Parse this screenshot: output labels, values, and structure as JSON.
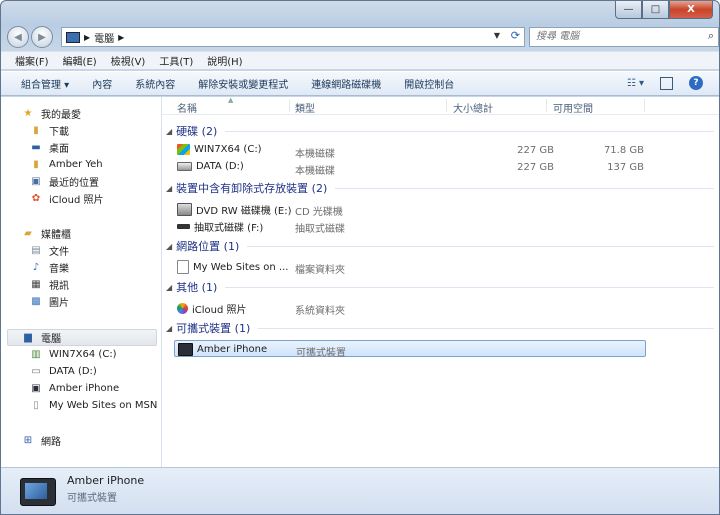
{
  "window": {
    "controls": {
      "minimize": "—",
      "maximize": "□",
      "close": "X"
    }
  },
  "address": {
    "breadcrumb": "電腦",
    "search_placeholder": "搜尋 電腦"
  },
  "menu": [
    "檔案(F)",
    "編輯(E)",
    "檢視(V)",
    "工具(T)",
    "說明(H)"
  ],
  "toolbar": {
    "items": [
      "組合管理 ▾",
      "內容",
      "系統內容",
      "解除安裝或變更程式",
      "連線網路磁碟機",
      "開啟控制台"
    ]
  },
  "nav": {
    "favorites_label": "我的最愛",
    "favorites": [
      "下載",
      "桌面",
      "Amber Yeh",
      "最近的位置",
      "iCloud 照片"
    ],
    "libraries_label": "媒體櫃",
    "libraries": [
      "文件",
      "音樂",
      "視訊",
      "圖片"
    ],
    "computer_label": "電腦",
    "computer": [
      "WIN7X64 (C:)",
      "DATA (D:)",
      "Amber iPhone",
      "My Web Sites on MSN"
    ],
    "network_label": "網路"
  },
  "columns": [
    "名稱",
    "類型",
    "大小總計",
    "可用空間"
  ],
  "groups": [
    {
      "title": "硬碟 (2)",
      "items": [
        {
          "name": "WIN7X64 (C:)",
          "type": "本機磁碟",
          "total": "227 GB",
          "free": "71.8 GB"
        },
        {
          "name": "DATA (D:)",
          "type": "本機磁碟",
          "total": "227 GB",
          "free": "137 GB"
        }
      ]
    },
    {
      "title": "裝置中含有卸除式存放裝置 (2)",
      "items": [
        {
          "name": "DVD RW 磁碟機 (E:)",
          "type": "CD 光碟機"
        },
        {
          "name": "抽取式磁碟 (F:)",
          "type": "抽取式磁碟"
        }
      ]
    },
    {
      "title": "網路位置 (1)",
      "items": [
        {
          "name": "My Web Sites on ...",
          "type": "檔案資料夾"
        }
      ]
    },
    {
      "title": "其他 (1)",
      "items": [
        {
          "name": "iCloud 照片",
          "type": "系統資料夾"
        }
      ]
    },
    {
      "title": "可攜式裝置 (1)",
      "items": [
        {
          "name": "Amber iPhone",
          "type": "可攜式裝置"
        }
      ]
    }
  ],
  "status": {
    "name": "Amber iPhone",
    "type": "可攜式裝置"
  },
  "colors": {
    "group_title": "#1e3287",
    "selection": "#cfe4fb",
    "accent": "#2a62b7"
  }
}
